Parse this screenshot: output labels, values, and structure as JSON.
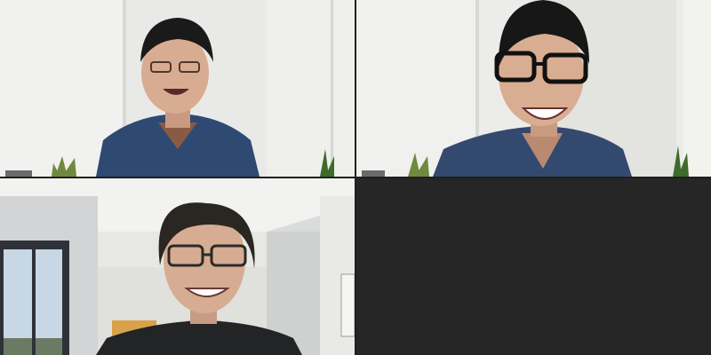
{
  "meeting": {
    "participant_count": 3,
    "empty_tile_color": "#262626",
    "divider_color": "#1f1f1f"
  }
}
